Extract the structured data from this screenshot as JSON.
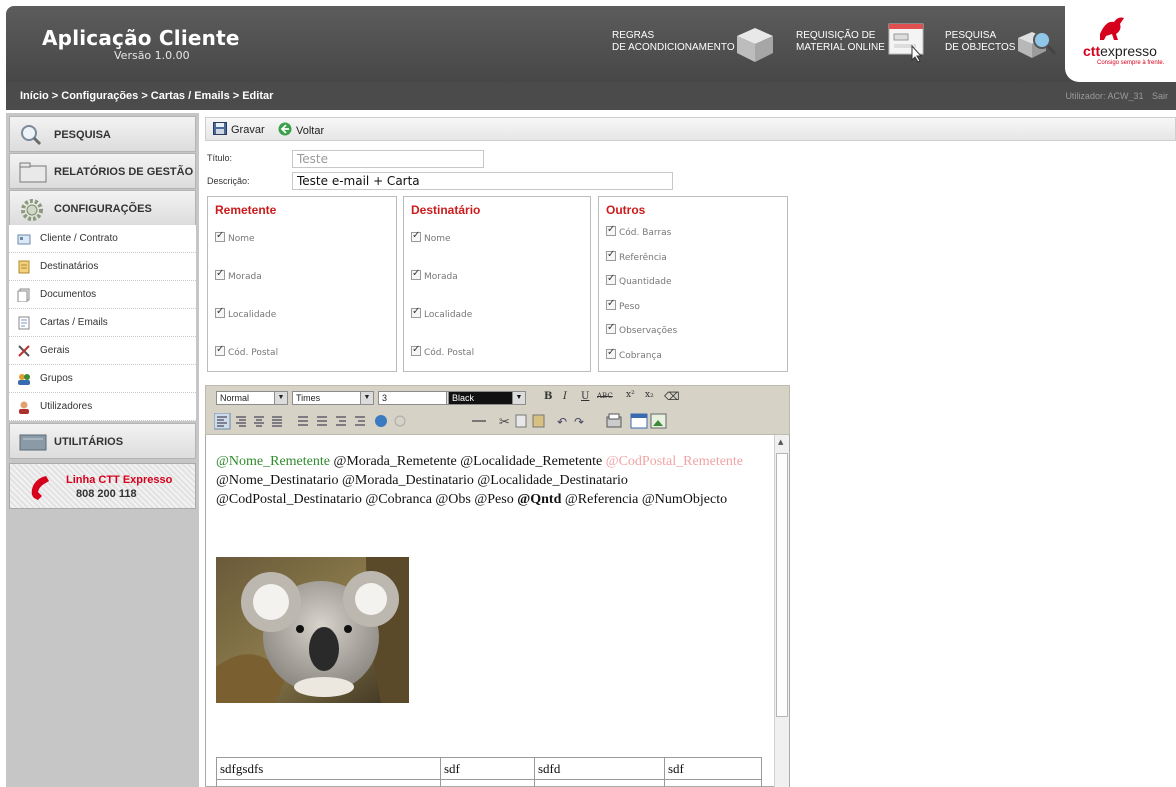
{
  "header": {
    "app_title": "Aplicação Cliente",
    "app_version": "Versão 1.0.00",
    "nav": [
      {
        "line1": "REGRAS",
        "line2": "DE ACONDICIONAMENTO",
        "icon": "box-icon"
      },
      {
        "line1": "REQUISIÇÃO DE",
        "line2": "MATERIAL ONLINE",
        "icon": "form-pointer-icon"
      },
      {
        "line1": "PESQUISA",
        "line2": "DE OBJECTOS",
        "icon": "magnifier-icon"
      }
    ],
    "logo_brand": "ctt",
    "logo_name": "expresso",
    "logo_tagline": "Consigo sempre à frente."
  },
  "breadcrumb": {
    "path": "Início > Configurações > Cartas / Emails > Editar",
    "user": "Utilizador: ACW_31",
    "logout": "Sair"
  },
  "sidebar": {
    "pesquisa": "PESQUISA",
    "relatorios": "RELATÓRIOS DE GESTÃO",
    "configuracoes": "CONFIGURAÇÕES",
    "items": [
      {
        "label": "Cliente / Contrato",
        "icon": "card-icon"
      },
      {
        "label": "Destinatários",
        "icon": "address-book-icon"
      },
      {
        "label": "Documentos",
        "icon": "documents-icon"
      },
      {
        "label": "Cartas / Emails",
        "icon": "letter-icon"
      },
      {
        "label": "Gerais",
        "icon": "tools-icon"
      },
      {
        "label": "Grupos",
        "icon": "group-icon"
      },
      {
        "label": "Utilizadores",
        "icon": "user-icon"
      }
    ],
    "utilitarios": "UTILITÁRIOS",
    "hotline_title": "Linha CTT Expresso",
    "hotline_number": "808 200 118"
  },
  "toolbar": {
    "save_label": "Gravar",
    "back_label": "Voltar"
  },
  "form": {
    "title_label": "Título:",
    "title_value": "Teste",
    "desc_label": "Descrição:",
    "desc_value": "Teste e-mail + Carta"
  },
  "groups": {
    "remetente": {
      "title": "Remetente",
      "items": [
        "Nome",
        "Morada",
        "Localidade",
        "Cód. Postal"
      ]
    },
    "destinatario": {
      "title": "Destinatário",
      "items": [
        "Nome",
        "Morada",
        "Localidade",
        "Cód. Postal"
      ]
    },
    "outros": {
      "title": "Outros",
      "items": [
        "Cód. Barras",
        "Referência",
        "Quantidade",
        "Peso",
        "Observações",
        "Cobrança"
      ]
    }
  },
  "editor": {
    "format": "Normal",
    "font": "Times",
    "size": "3",
    "color": "Black",
    "content": {
      "nome_rem": "@Nome_Remetente",
      "line1_rest": " @Morada_Remetente @Localidade_Remetente ",
      "codpostal_rem": "@CodPostal_Remetente",
      "line2": "@Nome_Destinatario @Morada_Destinatario @Localidade_Destinatario",
      "line3_start": "@CodPostal_Destinatario @Cobranca @Obs @Peso ",
      "qntd": "@Qntd",
      "line3_end": " @Referencia @NumObjecto"
    },
    "table": [
      [
        "sdfgsdfs",
        "sdf",
        "sdfd",
        "sdf"
      ]
    ]
  },
  "colors": {
    "header_bg": "#4b4b4b",
    "accent_red": "#cc1b1b",
    "ctt_red": "#d6001c",
    "green_text": "#2e8b2e",
    "pink_text": "#f2a4a4"
  }
}
